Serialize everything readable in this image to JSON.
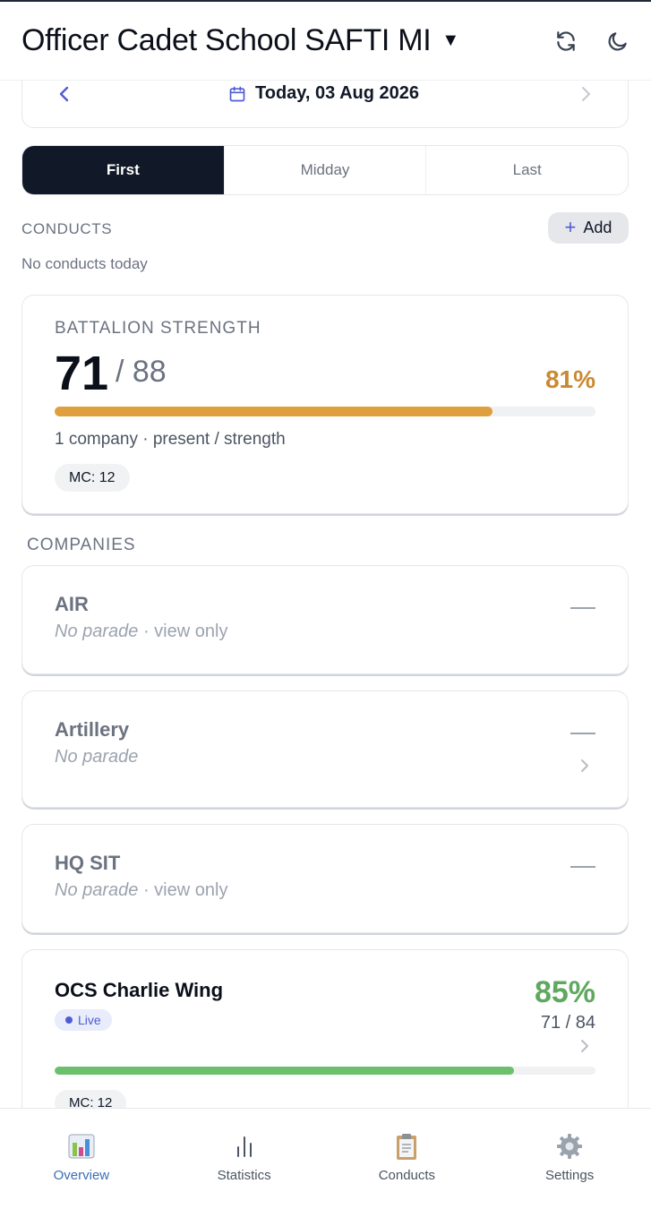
{
  "header": {
    "title": "Officer Cadet School SAFTI MI",
    "caret": "▼"
  },
  "date_nav": {
    "label": "Today, 03 Aug 2026"
  },
  "periods": [
    {
      "label": "First",
      "active": true
    },
    {
      "label": "Midday",
      "active": false
    },
    {
      "label": "Last",
      "active": false
    }
  ],
  "conducts": {
    "section_label": "CONDUCTS",
    "add_label": "Add",
    "empty_text": "No conducts today"
  },
  "battalion_strength": {
    "label": "BATTALION STRENGTH",
    "present": "71",
    "total": "/ 88",
    "percent_text": "81%",
    "percent_value": 81,
    "bar_color": "#e09f3e",
    "subtitle": "1 company · present / strength",
    "mc_badge": "MC: 12"
  },
  "companies": {
    "section_label": "COMPANIES",
    "items": [
      {
        "name": "AIR",
        "status": "No parade",
        "suffix": "· view only",
        "dash": "—"
      },
      {
        "name": "Artillery",
        "status": "No parade",
        "suffix": "",
        "dash": "—"
      },
      {
        "name": "HQ SIT",
        "status": "No parade",
        "suffix": "· view only",
        "dash": "—"
      }
    ],
    "featured": {
      "name": "OCS Charlie Wing",
      "badge": "Live",
      "percent_text": "85%",
      "percent_value": 85,
      "fraction": "71 / 84",
      "bar_color": "#6cc06c",
      "mc_badge": "MC: 12"
    }
  },
  "nav": [
    {
      "label": "Overview",
      "icon": "bar-chart-icon",
      "active": true
    },
    {
      "label": "Statistics",
      "icon": "statistics-icon",
      "active": false
    },
    {
      "label": "Conducts",
      "icon": "clipboard-icon",
      "active": false
    },
    {
      "label": "Settings",
      "icon": "gear-icon",
      "active": false
    }
  ],
  "colors": {
    "accent": "#4f5bd5",
    "dark": "#111827",
    "warning": "#c98a31",
    "success": "#5fa85f"
  }
}
